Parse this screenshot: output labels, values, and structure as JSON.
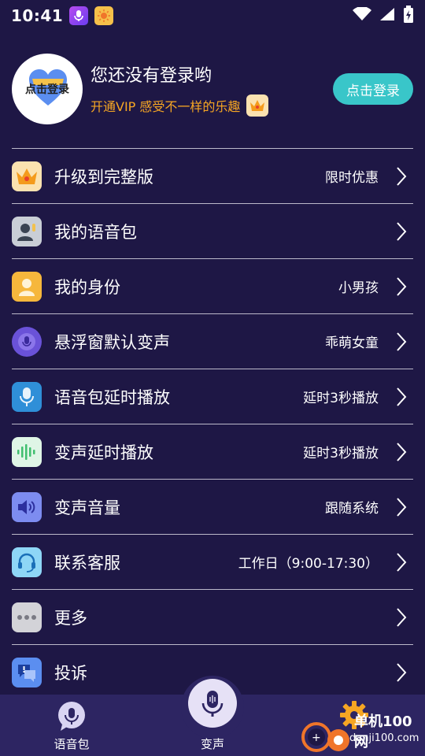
{
  "status_bar": {
    "time": "10:41",
    "icons": [
      "voice-changer-app-icon",
      "sun-app-icon",
      "wifi-icon",
      "signal-icon",
      "battery-charging-icon"
    ]
  },
  "profile": {
    "avatar_label": "点击登录",
    "title": "您还没有登录哟",
    "subtitle": "开通VIP 感受不一样的乐趣",
    "login_button": "点击登录"
  },
  "menu": {
    "items": [
      {
        "label": "升级到完整版",
        "value": "限时优惠",
        "icon": "crown-icon"
      },
      {
        "label": "我的语音包",
        "value": "",
        "icon": "voice-pack-user-icon"
      },
      {
        "label": "我的身份",
        "value": "小男孩",
        "icon": "person-icon"
      },
      {
        "label": "悬浮窗默认变声",
        "value": "乖萌女童",
        "icon": "floating-mic-icon"
      },
      {
        "label": "语音包延时播放",
        "value": "延时3秒播放",
        "icon": "microphone-icon"
      },
      {
        "label": "变声延时播放",
        "value": "延时3秒播放",
        "icon": "soundwave-icon"
      },
      {
        "label": "变声音量",
        "value": "跟随系统",
        "icon": "volume-icon"
      },
      {
        "label": "联系客服",
        "value": "工作日（9:00-17:30）",
        "icon": "headset-icon"
      },
      {
        "label": "更多",
        "value": "",
        "icon": "more-dots-icon"
      },
      {
        "label": "投诉",
        "value": "",
        "icon": "complaint-chat-icon"
      }
    ]
  },
  "bottom_nav": {
    "voice_pack": "语音包",
    "changer": "变声"
  },
  "watermark": {
    "cn": "单机100网",
    "en": "danji100.com"
  },
  "colors": {
    "background": "#1e1745",
    "nav_background": "#2d2562",
    "login_button": "#39c6c9",
    "vip_text": "#f6a623"
  }
}
